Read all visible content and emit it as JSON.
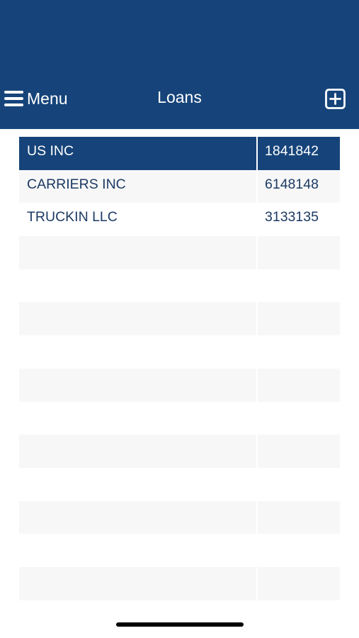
{
  "header": {
    "menu_label": "Menu",
    "title": "Loans",
    "menu_icon": "hamburger-icon",
    "add_icon": "plus-square-icon",
    "background_color": "#16447a"
  },
  "loans": [
    {
      "name": "US INC",
      "number": "1841842",
      "selected": true
    },
    {
      "name": "CARRIERS INC",
      "number": "6148148",
      "selected": false
    },
    {
      "name": "TRUCKIN LLC",
      "number": "3133135",
      "selected": false
    }
  ],
  "empty_row_count": 11,
  "colors": {
    "accent": "#16447a",
    "row_alt": "#f7f7f7",
    "text": "#1c3a63"
  }
}
